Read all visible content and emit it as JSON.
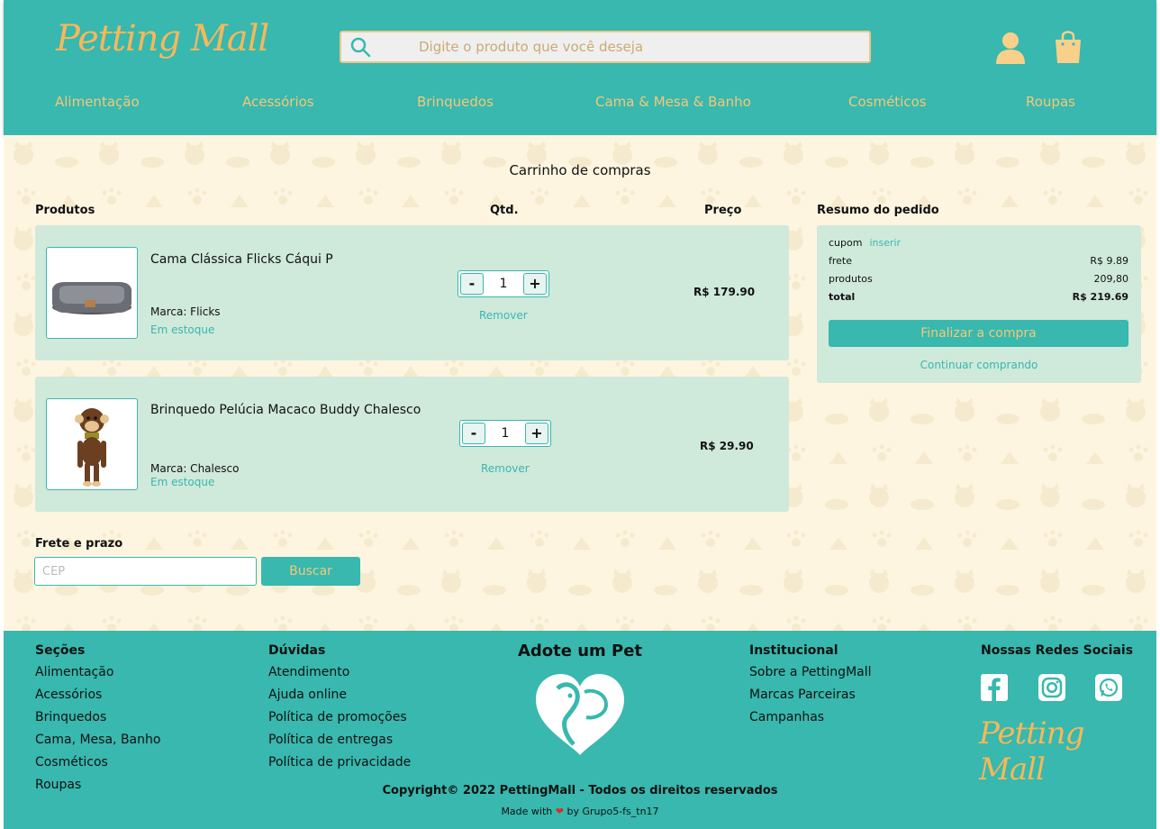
{
  "header": {
    "logo_text": "Petting Mall",
    "search_placeholder": "Digite o produto que você deseja",
    "nav": [
      "Alimentação",
      "Acessórios",
      "Brinquedos",
      "Cama & Mesa & Banho",
      "Cosméticos",
      "Roupas"
    ]
  },
  "cart": {
    "title": "Carrinho de compras",
    "col_products": "Produtos",
    "col_qty": "Qtd.",
    "col_price": "Preço",
    "remove_label": "Remover",
    "items": [
      {
        "name": "Cama Clássica Flicks Cáqui P",
        "brand": "Marca: Flicks",
        "stock": "Em estoque",
        "qty": "1",
        "price": "R$ 179.90",
        "image": "pet-bed-image"
      },
      {
        "name": "Brinquedo Pelúcia Macaco Buddy Chalesco",
        "brand": "Marca: Chalesco",
        "stock": "Em estoque",
        "qty": "1",
        "price": "R$ 29.90",
        "image": "monkey-plush-image"
      }
    ]
  },
  "summary": {
    "title": "Resumo do pedido",
    "coupon_label": "cupom",
    "coupon_link": "inserir",
    "freight_label": "frete",
    "freight_value": "R$ 9.89",
    "products_label": "produtos",
    "products_value": "209,80",
    "total_label": "total",
    "total_value": "R$ 219.69",
    "checkout_button": "Finalizar a compra",
    "continue_link": "Continuar comprando"
  },
  "freight": {
    "title": "Frete e prazo",
    "cep_placeholder": "CEP",
    "search_button": "Buscar"
  },
  "footer": {
    "sections_title": "Seções",
    "sections": [
      "Alimentação",
      "Acessórios",
      "Brinquedos",
      "Cama, Mesa, Banho",
      "Cosméticos",
      "Roupas"
    ],
    "questions_title": "Dúvidas",
    "questions": [
      "Atendimento",
      "Ajuda online",
      "Política de promoções",
      "Política de entregas",
      "Política de privacidade"
    ],
    "adopt_title": "Adote um Pet",
    "institutional_title": "Institucional",
    "institutional": [
      "Sobre a PettingMall",
      "Marcas Parceiras",
      "Campanhas"
    ],
    "social_title": "Nossas Redes Sociais",
    "social_icons": [
      "facebook-icon",
      "instagram-icon",
      "whatsapp-icon"
    ],
    "copyright": "Copyright© 2022 PettingMall - Todos os direitos reservados",
    "made_with_prefix": "Made with",
    "made_with_suffix": "by Grupo5-fs_tn17"
  },
  "colors": {
    "primary": "#38b8ae",
    "accent": "#f5c77a",
    "card": "#cfe9db",
    "background": "#fdf5e0"
  }
}
